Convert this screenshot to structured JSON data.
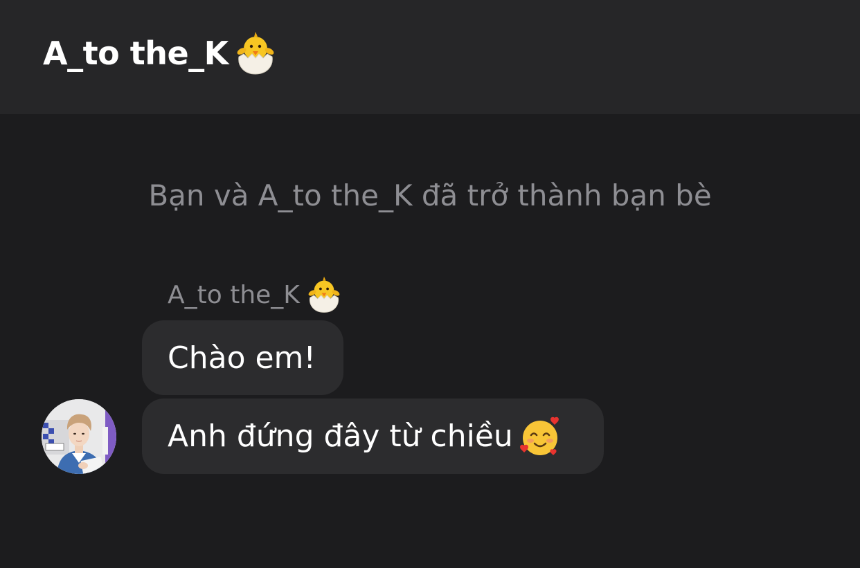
{
  "header": {
    "title": "A_to the_K",
    "title_icon": "hatching-chick-icon"
  },
  "conversation": {
    "system_message": "Bạn và A_to the_K đã trở thành bạn bè",
    "sender": {
      "name": "A_to the_K",
      "icon": "hatching-chick-icon",
      "avatar": "profile-photo"
    },
    "messages": [
      {
        "text": "Chào em!",
        "emoji": ""
      },
      {
        "text": "Anh đứng đây từ chiều",
        "emoji": "smiling-face-with-hearts-icon"
      }
    ]
  },
  "colors": {
    "background": "#1c1c1e",
    "header_background": "#262628",
    "bubble_background": "#2c2c2e",
    "secondary_text": "#8e8e93",
    "primary_text": "#ffffff"
  }
}
